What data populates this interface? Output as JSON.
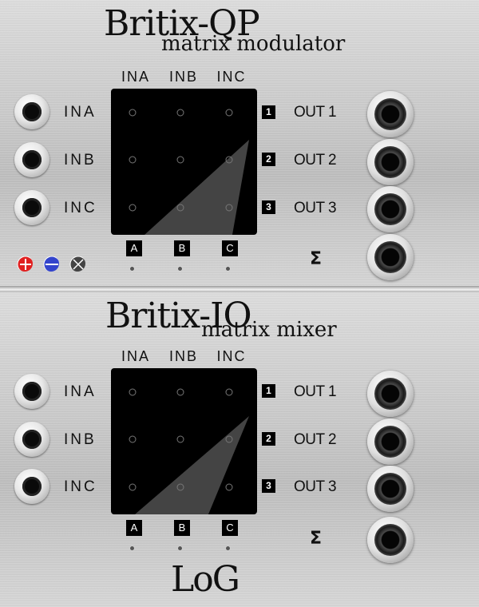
{
  "top_module": {
    "title": "Britix-QP",
    "subtitle": "matrix modulator",
    "column_labels": [
      "INA",
      "INB",
      "INC"
    ],
    "inputs": [
      "INA",
      "INB",
      "INC"
    ],
    "outputs": [
      "OUT 1",
      "OUT 2",
      "OUT 3"
    ],
    "row_numbers": [
      "1",
      "2",
      "3"
    ],
    "column_letters": [
      "A",
      "B",
      "C"
    ],
    "sum_symbol": "Σ",
    "legend_icons": [
      {
        "name": "plus-icon",
        "color": "#e02020"
      },
      {
        "name": "minus-icon",
        "color": "#3344cc"
      },
      {
        "name": "cross-icon",
        "color": "#444444"
      }
    ]
  },
  "bottom_module": {
    "title": "Britix-IO",
    "subtitle": "matrix mixer",
    "column_labels": [
      "INA",
      "INB",
      "INC"
    ],
    "inputs": [
      "INA",
      "INB",
      "INC"
    ],
    "outputs": [
      "OUT 1",
      "OUT 2",
      "OUT 3"
    ],
    "row_numbers": [
      "1",
      "2",
      "3"
    ],
    "column_letters": [
      "A",
      "B",
      "C"
    ],
    "sum_symbol": "Σ"
  },
  "logo": "LoG"
}
